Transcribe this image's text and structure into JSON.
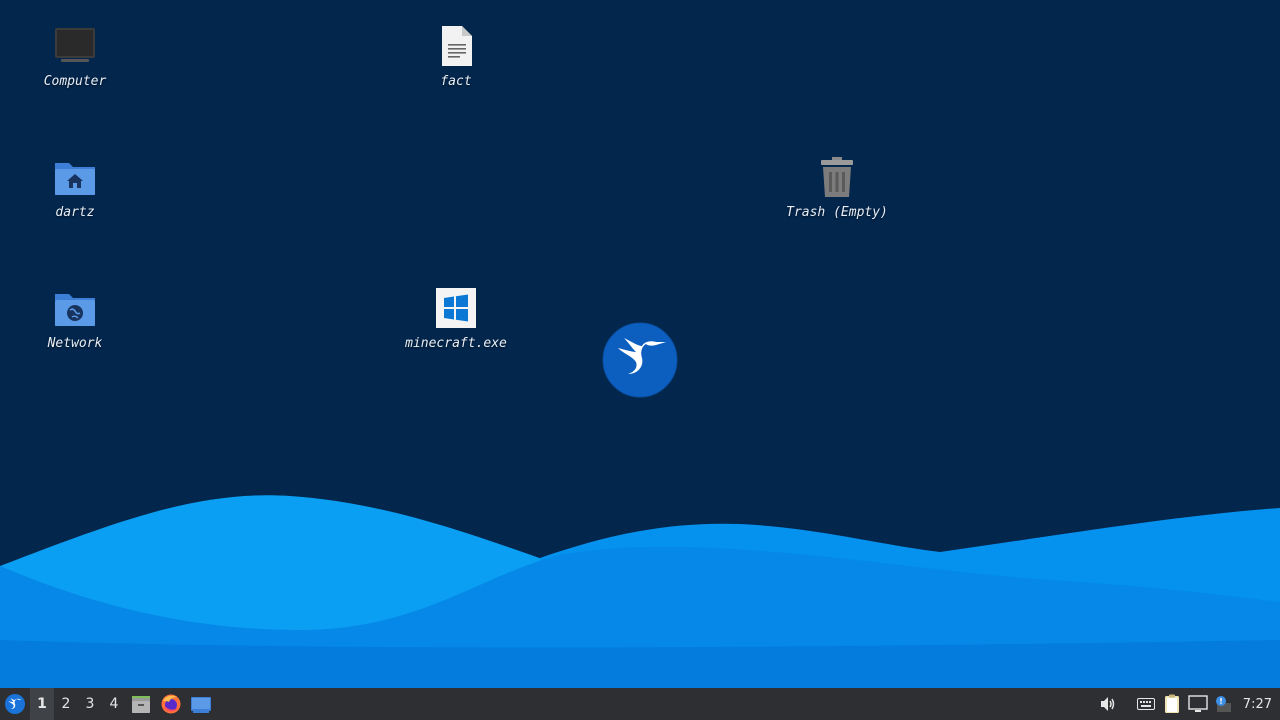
{
  "desktop": {
    "icons": [
      {
        "label": "Computer",
        "icon": "computer-icon"
      },
      {
        "label": "fact",
        "icon": "text-file-icon"
      },
      {
        "label": "dartz",
        "icon": "home-folder-icon"
      },
      {
        "label": "Trash (Empty)",
        "icon": "trash-icon"
      },
      {
        "label": "Network",
        "icon": "network-folder-icon"
      },
      {
        "label": "minecraft.exe",
        "icon": "windows-exe-icon"
      }
    ],
    "center_logo": "hummingbird-logo-icon"
  },
  "taskbar": {
    "menu_icon": "hummingbird-menu-icon",
    "workspaces": [
      "1",
      "2",
      "3",
      "4"
    ],
    "active_workspace": "1",
    "launchers": [
      "file-manager-icon",
      "firefox-icon",
      "show-desktop-icon"
    ],
    "tray": [
      "volume-icon",
      "keyboard-icon",
      "clipboard-icon",
      "network-icon",
      "notification-icon"
    ],
    "clock": "7:27"
  },
  "colors": {
    "desktop_bg": "#03264d",
    "wave_light": "#0a9ff2",
    "wave_mid": "#0588e8",
    "taskbar_bg": "#2d2f33"
  }
}
